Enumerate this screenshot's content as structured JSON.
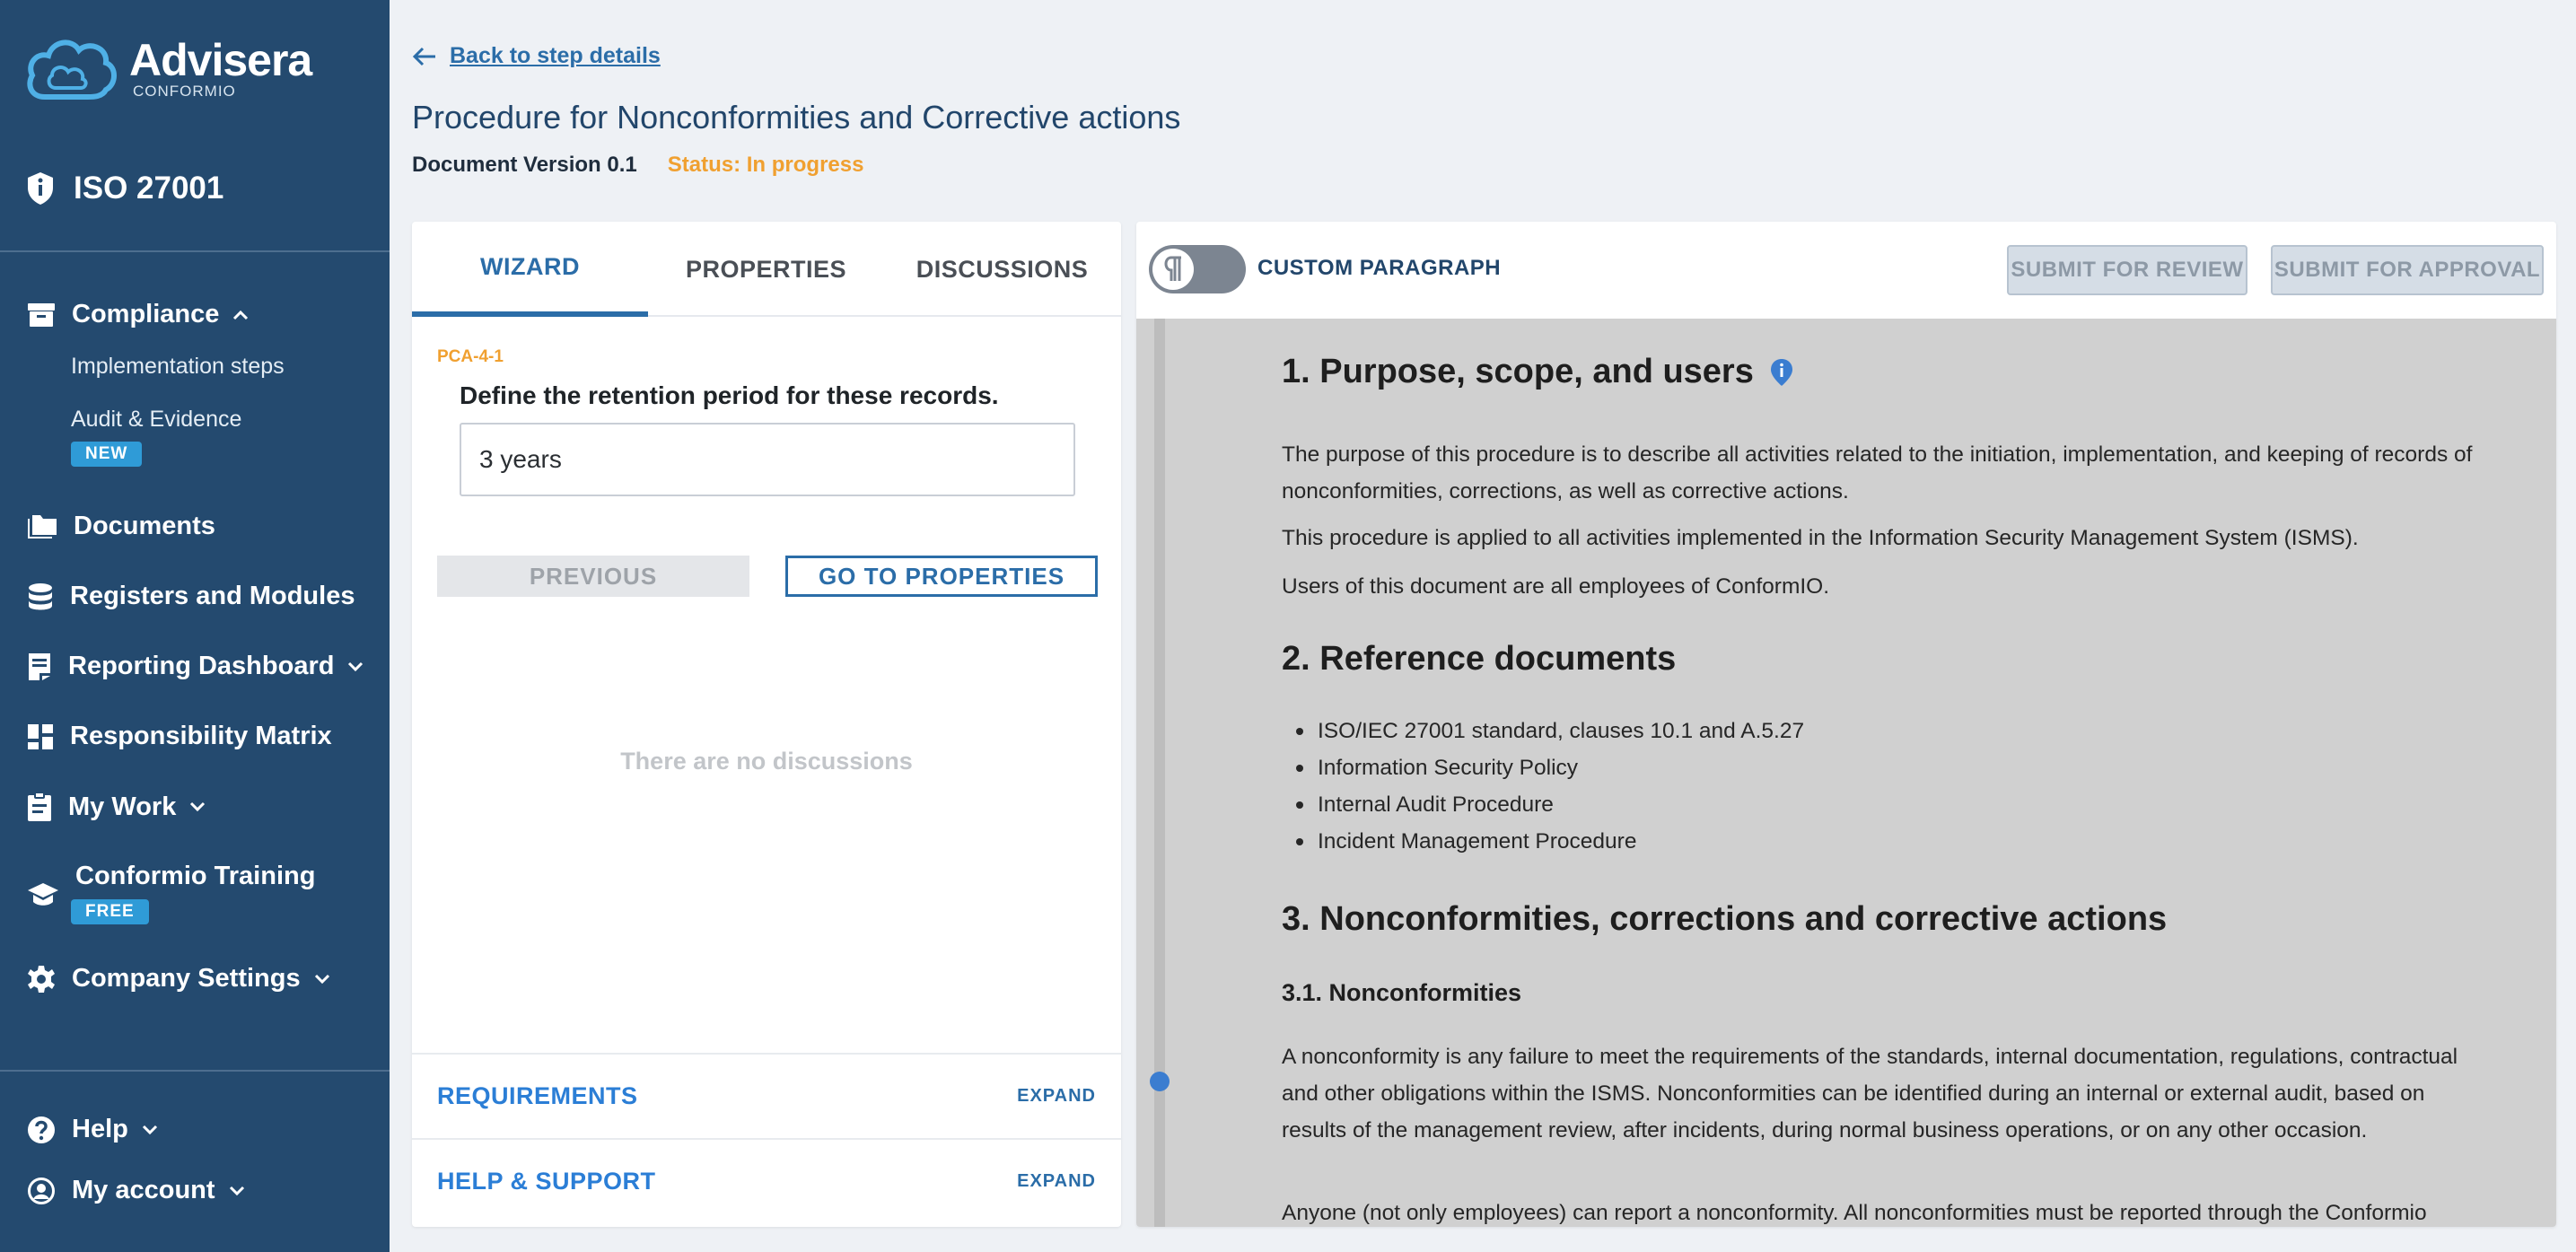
{
  "brand": {
    "name": "Advisera",
    "sub": "CONFORMIO"
  },
  "standard": "ISO 27001",
  "sidebar": {
    "compliance": "Compliance",
    "compliance_items": [
      "Implementation steps",
      "Audit & Evidence"
    ],
    "new_badge": "NEW",
    "documents": "Documents",
    "registers": "Registers and Modules",
    "reporting": "Reporting Dashboard",
    "responsibility": "Responsibility Matrix",
    "mywork": "My Work",
    "training": "Conformio Training",
    "free_badge": "FREE",
    "company": "Company Settings",
    "help": "Help",
    "account": "My account"
  },
  "header": {
    "back_label": "Back to step details",
    "title": "Procedure for Nonconformities and Corrective actions",
    "version": "Document Version 0.1",
    "status": "Status: In progress"
  },
  "wizard": {
    "tabs": [
      "WIZARD",
      "PROPERTIES",
      "DISCUSSIONS"
    ],
    "step_code": "PCA-4-1",
    "question": "Define the retention period for these records.",
    "answer": "3 years",
    "prev_label": "PREVIOUS",
    "next_label": "GO TO PROPERTIES",
    "no_discussions": "There are no discussions",
    "requirements": "REQUIREMENTS",
    "help_support": "HELP & SUPPORT",
    "expand": "EXPAND"
  },
  "editor": {
    "custom_paragraph": "CUSTOM PARAGRAPH",
    "submit_review": "SUBMIT FOR REVIEW",
    "submit_approval": "SUBMIT FOR APPROVAL"
  },
  "document": {
    "s1_title": "1. Purpose, scope, and users",
    "s1_p1": "The purpose of this procedure is to describe all activities related to the initiation, implementation, and keeping of records of nonconformities, corrections, as well as corrective actions.",
    "s1_p2": "This procedure is applied to all activities implemented in the Information Security Management System (ISMS).",
    "s1_p3": "Users of this document are all employees of ConformIO.",
    "s2_title": "2. Reference documents",
    "s2_items": [
      "ISO/IEC 27001 standard, clauses 10.1 and A.5.27",
      "Information Security Policy",
      "Internal Audit Procedure",
      "Incident Management Procedure"
    ],
    "s3_title": "3. Nonconformities, corrections and corrective actions",
    "s31_title": "3.1. Nonconformities",
    "s31_p1": "A nonconformity is any failure to meet the requirements of the standards, internal documentation, regulations, contractual and other obligations within the ISMS. Nonconformities can be identified during an internal or external audit, based on results of the management review, after incidents, during normal business operations, or on any other occasion.",
    "s31_p2": "Anyone (not only employees) can report a nonconformity. All nonconformities must be reported through the Conformio"
  }
}
